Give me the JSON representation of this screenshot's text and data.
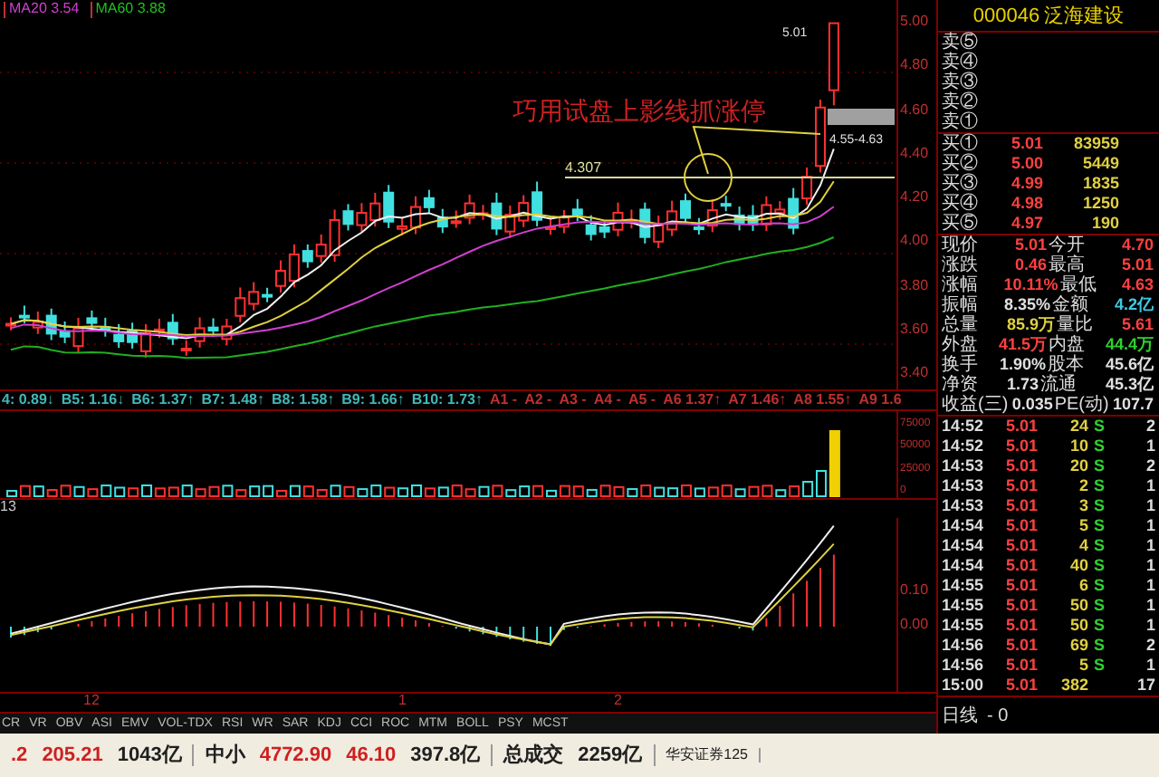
{
  "ma_legend": [
    {
      "text": "MA20 3.54",
      "color": "#d040d0"
    },
    {
      "text": "MA60 3.88",
      "color": "#20c020"
    }
  ],
  "price_chart": {
    "axis_labels": [
      "5.00",
      "4.80",
      "4.60",
      "4.40",
      "4.20",
      "4.00",
      "3.80",
      "3.60",
      "3.40"
    ],
    "annotation_title": "巧用试盘上影线抓涨停",
    "support_label": "4.307",
    "range_label": "4.55-4.63",
    "high_label": "5.01"
  },
  "indicator_readings": [
    {
      "text": "4: 0.89↓",
      "kind": "b"
    },
    {
      "text": "B5: 1.16↓",
      "kind": "b"
    },
    {
      "text": "B6: 1.37↑",
      "kind": "b"
    },
    {
      "text": "B7: 1.48↑",
      "kind": "b"
    },
    {
      "text": "B8: 1.58↑",
      "kind": "b"
    },
    {
      "text": "B9: 1.66↑",
      "kind": "b"
    },
    {
      "text": "B10: 1.73↑",
      "kind": "b"
    },
    {
      "text": "A1 -",
      "kind": "a"
    },
    {
      "text": "A2 -",
      "kind": "a"
    },
    {
      "text": "A3 -",
      "kind": "a"
    },
    {
      "text": "A4 -",
      "kind": "a"
    },
    {
      "text": "A5 -",
      "kind": "a"
    },
    {
      "text": "A6 1.37↑",
      "kind": "a"
    },
    {
      "text": "A7 1.46↑",
      "kind": "a"
    },
    {
      "text": "A8 1.55↑",
      "kind": "a"
    },
    {
      "text": "A9 1.6",
      "kind": "a"
    }
  ],
  "volume_axis": [
    "75000",
    "50000",
    "25000",
    "0"
  ],
  "macd": {
    "label": "13",
    "axis_labels": [
      "0.10",
      "0.00"
    ]
  },
  "x_axis": [
    "12",
    "1",
    "2"
  ],
  "indicator_tabs": [
    "CR",
    "VR",
    "OBV",
    "ASI",
    "EMV",
    "VOL-TDX",
    "RSI",
    "WR",
    "SAR",
    "KDJ",
    "CCI",
    "ROC",
    "MTM",
    "BOLL",
    "PSY",
    "MCST"
  ],
  "quote_panel": {
    "code": "000046",
    "name": "泛海建设",
    "sell": [
      {
        "label": "卖⑤"
      },
      {
        "label": "卖④"
      },
      {
        "label": "卖③"
      },
      {
        "label": "卖②"
      },
      {
        "label": "卖①"
      }
    ],
    "buy": [
      {
        "label": "买①",
        "price": "5.01",
        "volume": "83959"
      },
      {
        "label": "买②",
        "price": "5.00",
        "volume": "5449"
      },
      {
        "label": "买③",
        "price": "4.99",
        "volume": "1835"
      },
      {
        "label": "买④",
        "price": "4.98",
        "volume": "1250"
      },
      {
        "label": "买⑤",
        "price": "4.97",
        "volume": "190"
      }
    ],
    "stats": [
      {
        "label": "现价",
        "value": "5.01",
        "color": "#ff4040"
      },
      {
        "label": "今开",
        "value": "4.70",
        "color": "#ff4040"
      },
      {
        "label": "涨跌",
        "value": "0.46",
        "color": "#ff4040"
      },
      {
        "label": "最高",
        "value": "5.01",
        "color": "#ff4040"
      },
      {
        "label": "涨幅",
        "value": "10.11%",
        "color": "#ff4040"
      },
      {
        "label": "最低",
        "value": "4.63",
        "color": "#ff4040"
      },
      {
        "label": "振幅",
        "value": "8.35%",
        "color": "#e0e0e0"
      },
      {
        "label": "金额",
        "value": "4.2亿",
        "color": "#40c8e0"
      },
      {
        "label": "总量",
        "value": "85.9万",
        "color": "#e0d040"
      },
      {
        "label": "量比",
        "value": "5.61",
        "color": "#ff4040"
      },
      {
        "label": "外盘",
        "value": "41.5万",
        "color": "#ff4040"
      },
      {
        "label": "内盘",
        "value": "44.4万",
        "color": "#30d030"
      },
      {
        "label": "换手",
        "value": "1.90%",
        "color": "#e0e0e0"
      },
      {
        "label": "股本",
        "value": "45.6亿",
        "color": "#e0e0e0"
      },
      {
        "label": "净资",
        "value": "1.73",
        "color": "#e0e0e0"
      },
      {
        "label": "流通",
        "value": "45.3亿",
        "color": "#e0e0e0"
      },
      {
        "label": "收益(三)",
        "value": "0.035",
        "color": "#e0e0e0"
      },
      {
        "label": "PE(动)",
        "value": "107.7",
        "color": "#e0e0e0"
      }
    ],
    "ticks": [
      {
        "time": "14:52",
        "price": "5.01",
        "volume": "24",
        "side": "S",
        "count": "2"
      },
      {
        "time": "14:52",
        "price": "5.01",
        "volume": "10",
        "side": "S",
        "count": "1"
      },
      {
        "time": "14:53",
        "price": "5.01",
        "volume": "20",
        "side": "S",
        "count": "2"
      },
      {
        "time": "14:53",
        "price": "5.01",
        "volume": "2",
        "side": "S",
        "count": "1"
      },
      {
        "time": "14:53",
        "price": "5.01",
        "volume": "3",
        "side": "S",
        "count": "1"
      },
      {
        "time": "14:54",
        "price": "5.01",
        "volume": "5",
        "side": "S",
        "count": "1"
      },
      {
        "time": "14:54",
        "price": "5.01",
        "volume": "4",
        "side": "S",
        "count": "1"
      },
      {
        "time": "14:54",
        "price": "5.01",
        "volume": "40",
        "side": "S",
        "count": "1"
      },
      {
        "time": "14:55",
        "price": "5.01",
        "volume": "6",
        "side": "S",
        "count": "1"
      },
      {
        "time": "14:55",
        "price": "5.01",
        "volume": "50",
        "side": "S",
        "count": "1"
      },
      {
        "time": "14:55",
        "price": "5.01",
        "volume": "50",
        "side": "S",
        "count": "1"
      },
      {
        "time": "14:56",
        "price": "5.01",
        "volume": "69",
        "side": "S",
        "count": "2"
      },
      {
        "time": "14:56",
        "price": "5.01",
        "volume": "5",
        "side": "S",
        "count": "1"
      },
      {
        "time": "15:00",
        "price": "5.01",
        "volume": "382",
        "count": "17"
      }
    ],
    "period": "日线",
    "period_offset": "- 0"
  },
  "status_bar": [
    [
      {
        "text": ".2",
        "color": "#d02020"
      },
      {
        "text": "205.21",
        "color": "#d02020"
      },
      {
        "text": "1043亿",
        "color": "#202020"
      }
    ],
    [
      {
        "text": "中小",
        "color": "#202020"
      },
      {
        "text": "4772.90",
        "color": "#d02020"
      },
      {
        "text": "46.10",
        "color": "#d02020"
      },
      {
        "text": "397.8亿",
        "color": "#202020"
      }
    ],
    [
      {
        "text": "总成交",
        "color": "#202020"
      },
      {
        "text": "2259亿",
        "color": "#202020"
      }
    ],
    [
      {
        "text": "华安证券125",
        "color": "#202020"
      }
    ]
  ]
}
